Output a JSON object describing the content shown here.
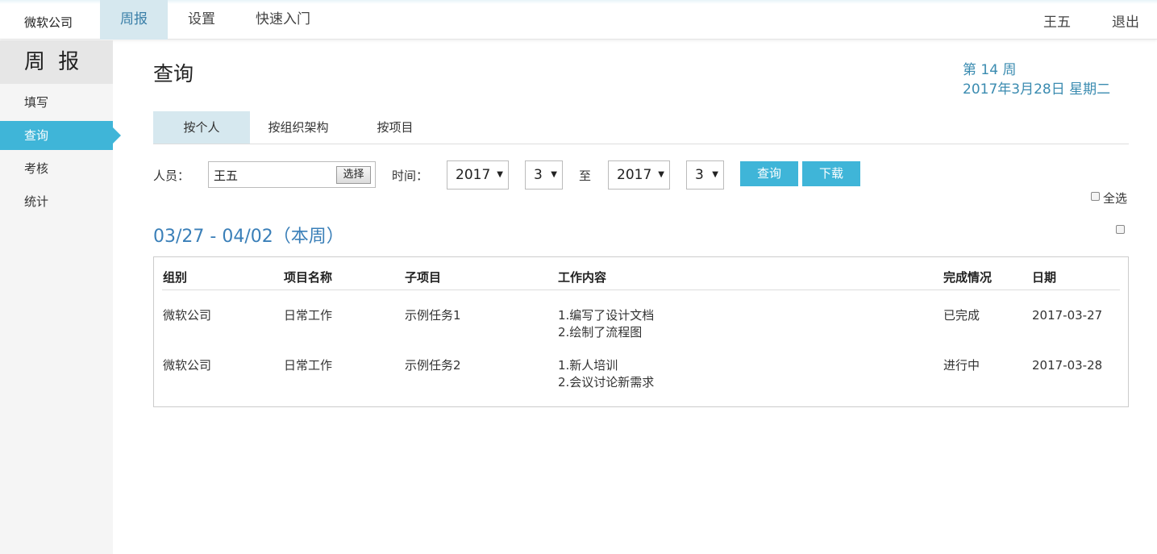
{
  "header": {
    "brand": "微软公司",
    "nav": [
      {
        "label": "周报",
        "active": true
      },
      {
        "label": "设置",
        "active": false
      },
      {
        "label": "快速入门",
        "active": false
      }
    ],
    "user": "王五",
    "logout": "退出"
  },
  "sidebar": {
    "title": "周 报",
    "items": [
      {
        "label": "填写",
        "active": false
      },
      {
        "label": "查询",
        "active": true
      },
      {
        "label": "考核",
        "active": false
      },
      {
        "label": "统计",
        "active": false
      }
    ]
  },
  "main": {
    "title": "查询",
    "week_number": "第 14 周",
    "date": "2017年3月28日 星期二",
    "tabs": [
      {
        "label": "按个人",
        "active": true
      },
      {
        "label": "按组织架构",
        "active": false
      },
      {
        "label": "按项目",
        "active": false
      }
    ],
    "filter": {
      "person_label": "人员：",
      "person_value": "王五",
      "pick_label": "选择",
      "time_label": "时间：",
      "from_year": "2017",
      "from_month": "3",
      "to_label": "至",
      "to_year": "2017",
      "to_month": "3",
      "query_label": "查询",
      "download_label": "下载",
      "select_all_label": "全选"
    },
    "week_range": "03/27 - 04/02（本周）",
    "table": {
      "headers": [
        "组别",
        "项目名称",
        "子项目",
        "工作内容",
        "完成情况",
        "日期"
      ],
      "rows": [
        {
          "group": "微软公司",
          "project": "日常工作",
          "sub": "示例任务1",
          "content": [
            "1.编写了设计文档",
            "2.绘制了流程图"
          ],
          "status": "已完成",
          "date": "2017-03-27"
        },
        {
          "group": "微软公司",
          "project": "日常工作",
          "sub": "示例任务2",
          "content": [
            "1.新人培训",
            "2.会议讨论新需求"
          ],
          "status": "进行中",
          "date": "2017-03-28"
        }
      ]
    }
  },
  "colors": {
    "accent": "#3fb5d8",
    "active_tab": "#d6e8ef",
    "link_blue": "#3a7fb8"
  }
}
